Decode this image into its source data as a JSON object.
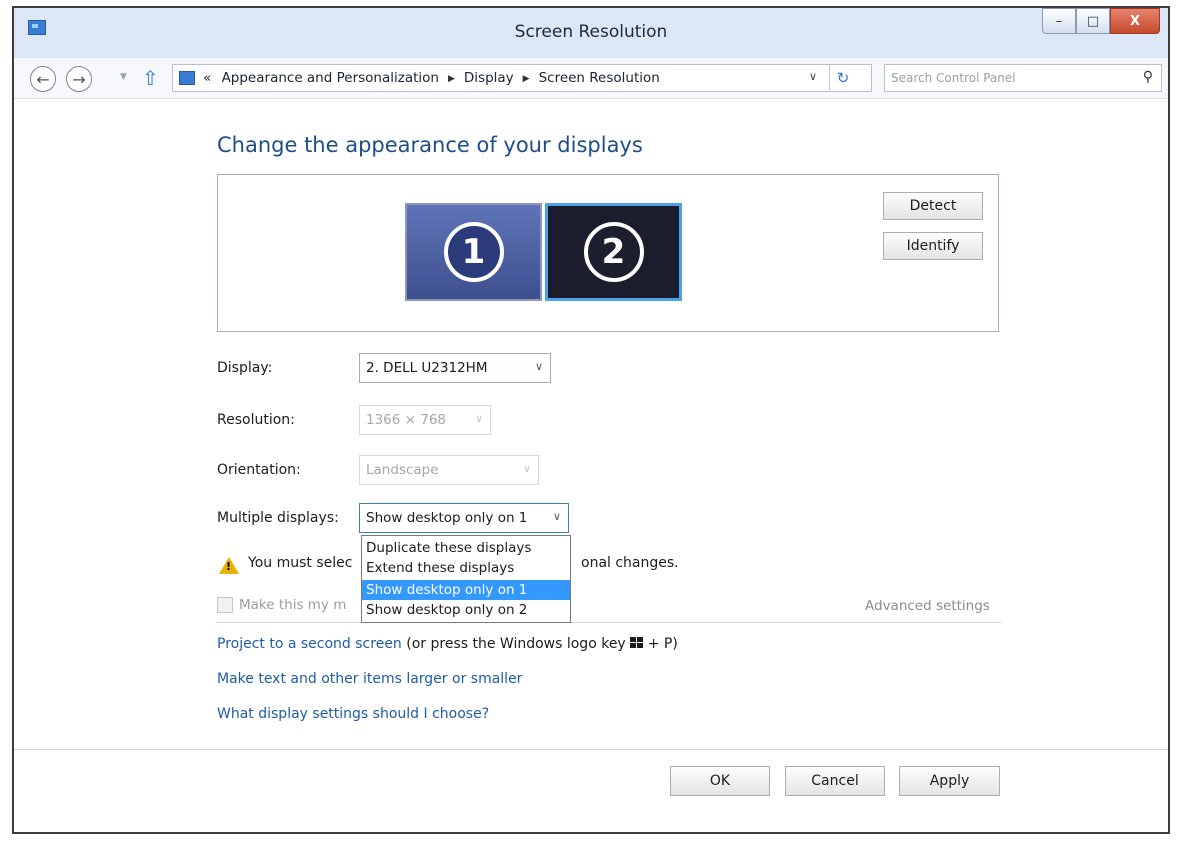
{
  "window": {
    "title": "Screen Resolution"
  },
  "controls": {
    "minimize": "–",
    "maximize": "□",
    "close": "X"
  },
  "nav": {
    "back": "←",
    "forward": "→",
    "breadcrumb_prefix": "«",
    "breadcrumb": [
      "Appearance and Personalization",
      "Display",
      "Screen Resolution"
    ],
    "search_placeholder": "Search Control Panel"
  },
  "heading": "Change the appearance of your displays",
  "monitors": [
    {
      "number": "1"
    },
    {
      "number": "2"
    }
  ],
  "buttons": {
    "detect": "Detect",
    "identify": "Identify",
    "ok": "OK",
    "cancel": "Cancel",
    "apply": "Apply"
  },
  "settings": {
    "display_label": "Display:",
    "display_value": "2. DELL U2312HM",
    "resolution_label": "Resolution:",
    "resolution_value": "1366 × 768",
    "orientation_label": "Orientation:",
    "orientation_value": "Landscape",
    "multiple_label": "Multiple displays:",
    "multiple_value": "Show desktop only on 1"
  },
  "multiple_options": [
    "Duplicate these displays",
    "Extend these displays",
    "Show desktop only on 1",
    "Show desktop only on 2"
  ],
  "warning": {
    "text_left": "You must selec",
    "text_right": "onal changes."
  },
  "checkbox": {
    "label": "Make this my m",
    "checked": false
  },
  "advanced_link": "Advanced settings",
  "links": {
    "project": "Project to a second screen",
    "project_suffix": "(or press the Windows logo key",
    "project_end": "+ P)",
    "text_size": "Make text and other items larger or smaller",
    "help": "What display settings should I choose?"
  }
}
